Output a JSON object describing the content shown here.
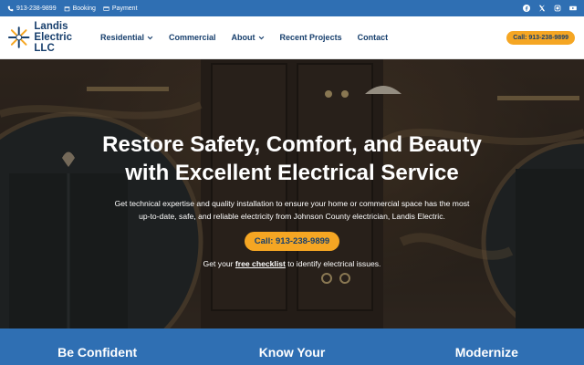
{
  "topbar": {
    "phone": "913-238-9899",
    "booking": "Booking",
    "payment": "Payment",
    "social_icons": [
      "facebook-icon",
      "x-icon",
      "instagram-icon",
      "youtube-icon"
    ]
  },
  "header": {
    "logo_line1": "Landis",
    "logo_line2": "Electric LLC",
    "nav": [
      "Residential",
      "Commercial",
      "About",
      "Recent Projects",
      "Contact"
    ],
    "call_button": "Call: 913-238-9899"
  },
  "hero": {
    "title": "Restore Safety, Comfort, and Beauty with Excellent Electrical Service",
    "subtitle": "Get technical expertise and quality installation to ensure your home or commercial space has the most up-to-date, safe, and reliable electricity from Johnson County electrician, Landis Electric.",
    "button": "Call: 913-238-9899",
    "note_before": "Get your ",
    "note_link": "free checklist",
    "note_after": " to identify electrical issues."
  },
  "band": {
    "col1": "Be Confident",
    "col2": "Know Your",
    "col3": "Modernize"
  },
  "colors": {
    "brand_blue": "#2f6fb3",
    "navy": "#163e6c",
    "accent_orange": "#f5a623"
  }
}
